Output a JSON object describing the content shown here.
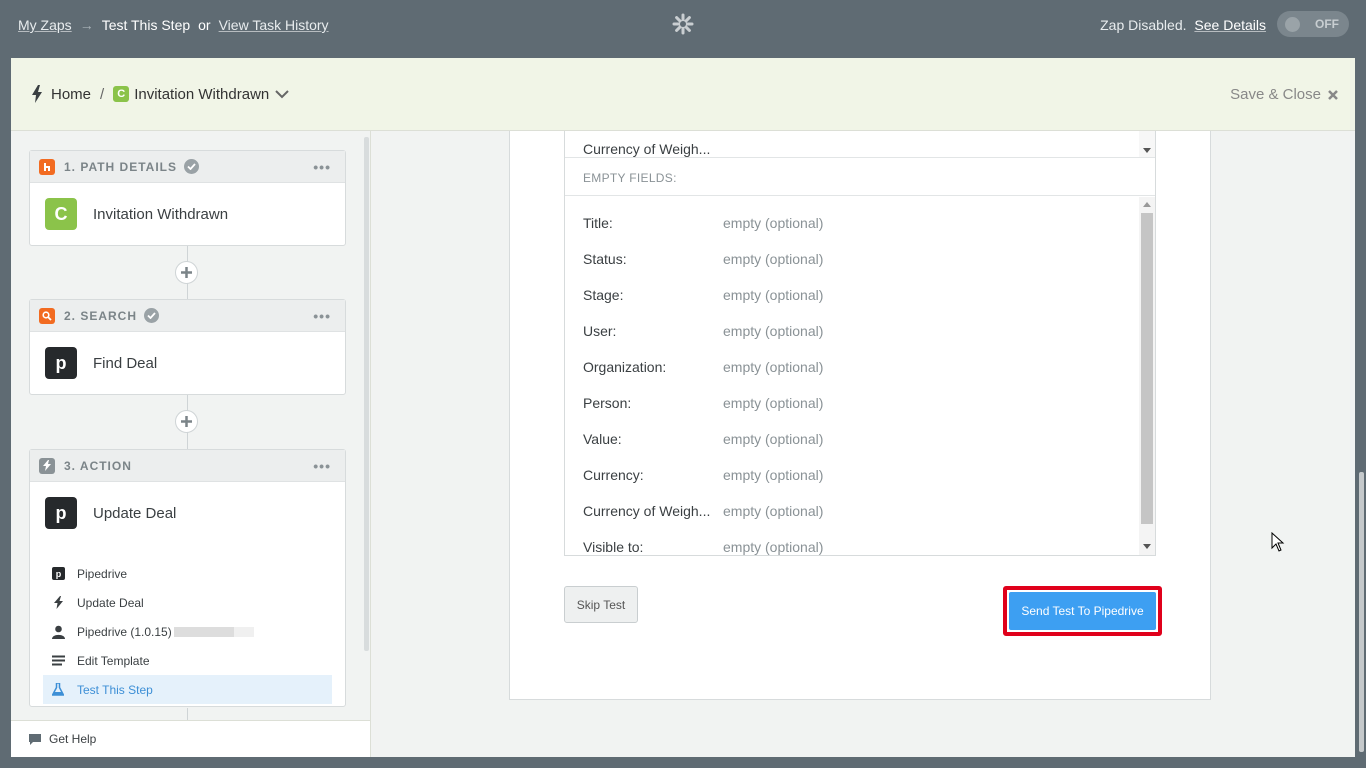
{
  "topbar": {
    "my_zaps": "My Zaps",
    "arrow": "→",
    "current": "Test This Step",
    "or": "or",
    "task_history": "View Task History",
    "zap_status": "Zap Disabled.",
    "see_details": "See Details",
    "toggle_label": "OFF"
  },
  "header": {
    "home": "Home",
    "separator": "/",
    "app_badge": "C",
    "zap_name": "Invitation Withdrawn",
    "save_close": "Save & Close"
  },
  "sidebar": {
    "steps": [
      {
        "title": "1. PATH DETAILS",
        "app_badge": "C",
        "app_name": "Invitation Withdrawn",
        "color": "#f26b21"
      },
      {
        "title": "2. SEARCH",
        "app_badge": "p",
        "app_name": "Find Deal",
        "color": "#f26b21"
      },
      {
        "title": "3. ACTION",
        "app_badge": "p",
        "app_name": "Update Deal",
        "color": "#8a9296"
      }
    ],
    "sub_items": [
      {
        "label": "Pipedrive",
        "icon": "pipedrive-icon"
      },
      {
        "label": "Update Deal",
        "icon": "bolt-icon"
      },
      {
        "label": "Pipedrive (1.0.15)",
        "icon": "user-icon"
      },
      {
        "label": "Edit Template",
        "icon": "lines-icon"
      },
      {
        "label": "Test This Step",
        "icon": "flask-icon"
      }
    ],
    "get_help": "Get Help"
  },
  "main": {
    "prev_field": "Currency of Weigh...",
    "empty_fields_header": "EMPTY FIELDS:",
    "fields": [
      {
        "key": "Title:",
        "value": "empty (optional)"
      },
      {
        "key": "Status:",
        "value": "empty (optional)"
      },
      {
        "key": "Stage:",
        "value": "empty (optional)"
      },
      {
        "key": "User:",
        "value": "empty (optional)"
      },
      {
        "key": "Organization:",
        "value": "empty (optional)"
      },
      {
        "key": "Person:",
        "value": "empty (optional)"
      },
      {
        "key": "Value:",
        "value": "empty (optional)"
      },
      {
        "key": "Currency:",
        "value": "empty (optional)"
      },
      {
        "key": "Currency of Weigh...",
        "value": "empty (optional)"
      },
      {
        "key": "Visible to:",
        "value": "empty (optional)"
      }
    ],
    "skip_test": "Skip Test",
    "send_test": "Send Test To Pipedrive"
  },
  "colors": {
    "topbar": "#5f6b73",
    "header_bg": "#f1f5e7",
    "accent_blue": "#3d9ff2",
    "highlight_red": "#e0001b",
    "app_green": "#8bc34a"
  }
}
